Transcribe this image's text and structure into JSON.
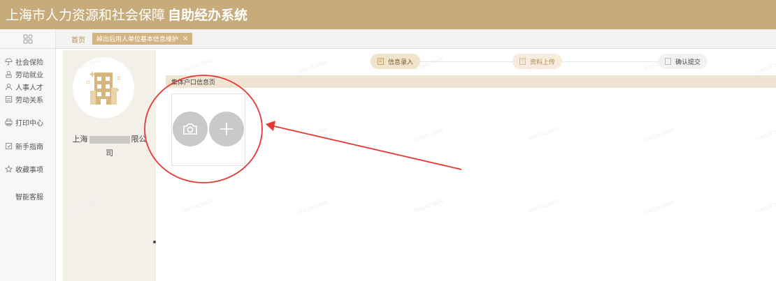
{
  "header": {
    "title_main": "上海市人力资源和社会保障",
    "title_bold": "自助经办系统"
  },
  "sidebar": {
    "items": [
      {
        "label": "社会保险",
        "icon": "umbrella-icon"
      },
      {
        "label": "劳动就业",
        "icon": "briefcase-icon"
      },
      {
        "label": "人事人才",
        "icon": "people-icon"
      },
      {
        "label": "劳动关系",
        "icon": "form-icon"
      },
      {
        "label": "打印中心",
        "icon": "printer-icon"
      },
      {
        "label": "新手指南",
        "icon": "guide-icon"
      },
      {
        "label": "收藏事项",
        "icon": "star-icon"
      },
      {
        "label": "智能客服",
        "icon": ""
      }
    ]
  },
  "tabs": {
    "home": "首页",
    "active": "掉出后用人单位基本信息维护",
    "close": "×"
  },
  "profile": {
    "company_prefix": "上海",
    "company_suffix": "限公",
    "company_line2": "司"
  },
  "steps": [
    {
      "label": "信息录入",
      "state": "current"
    },
    {
      "label": "资料上传",
      "state": "next"
    },
    {
      "label": "确认提交",
      "state": "pending"
    }
  ],
  "section": {
    "title": "集体户口信息页"
  },
  "watermark": "00010C3666",
  "colors": {
    "brand": "#c8ab7b",
    "tab_active": "#d4b483",
    "section_bg": "#efe4d1",
    "annotation": "#e53935"
  }
}
